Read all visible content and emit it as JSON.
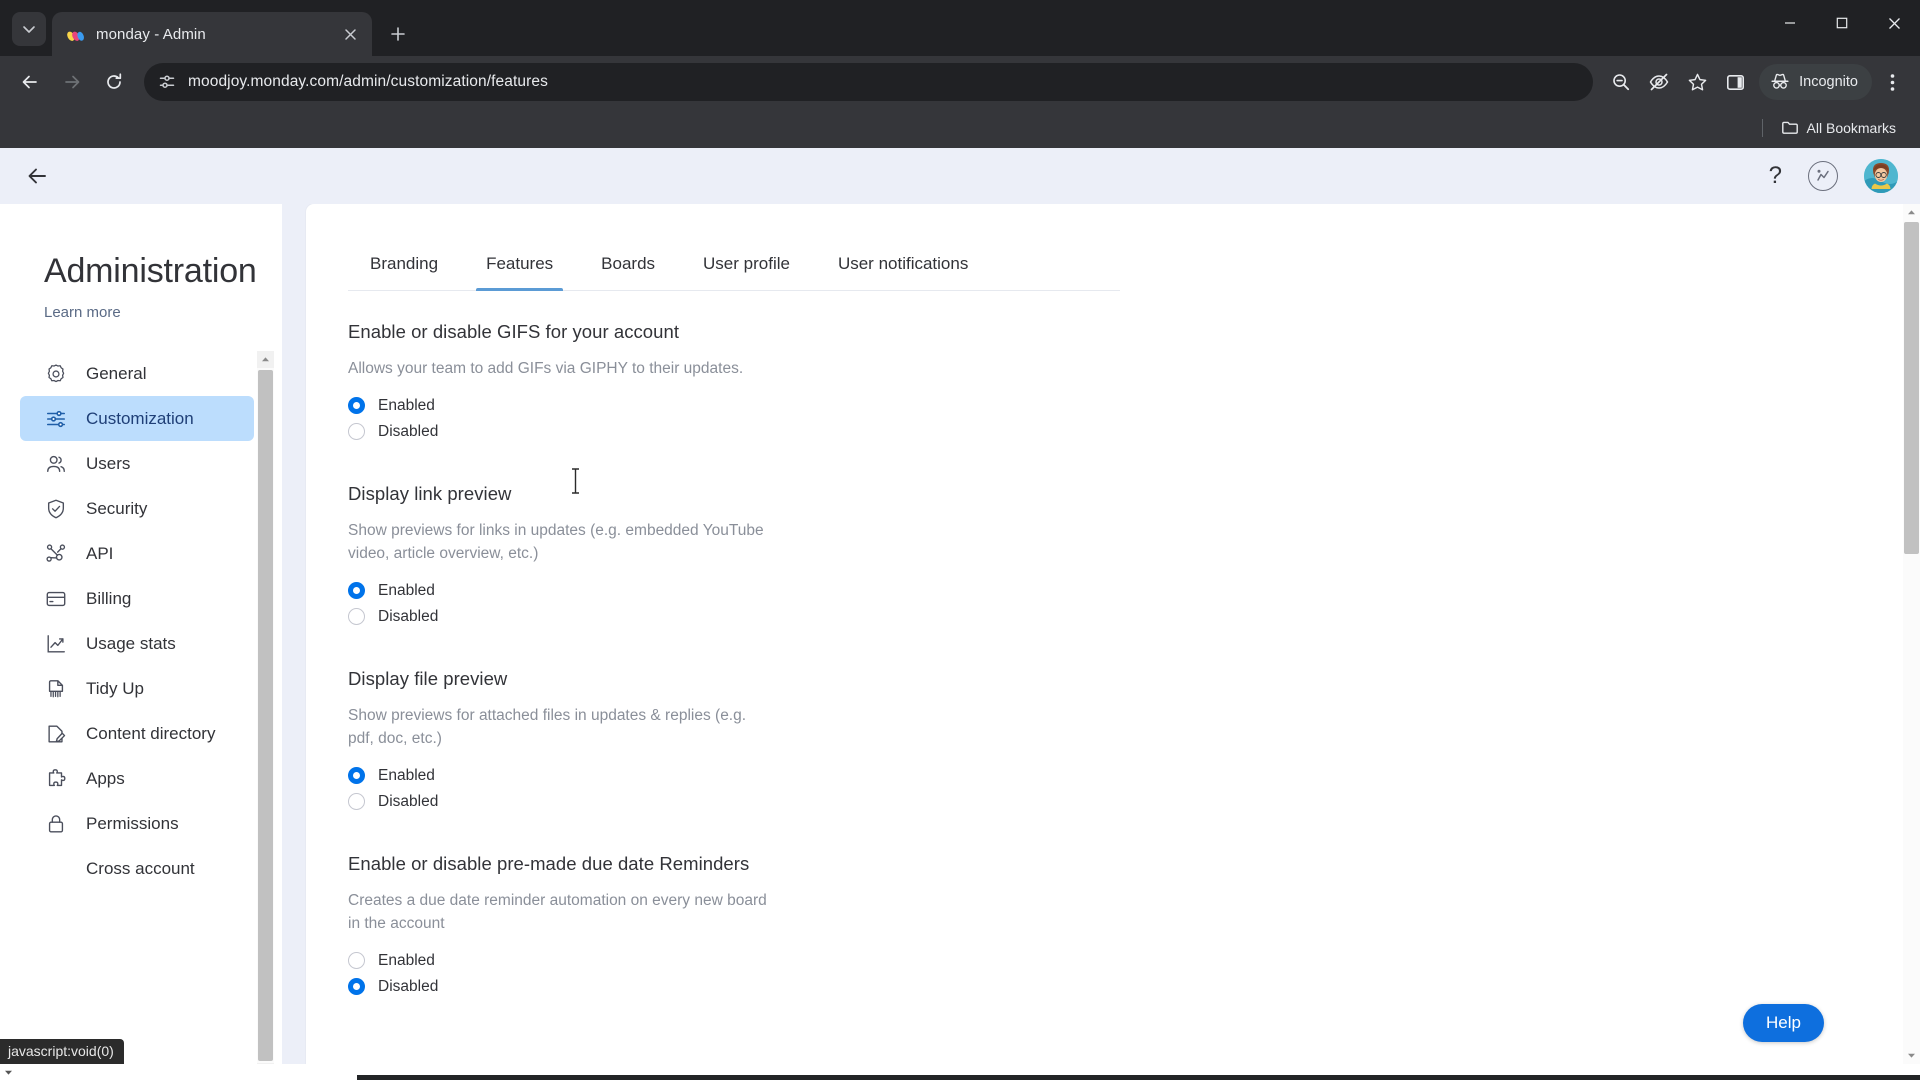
{
  "browser": {
    "tab": {
      "title": "monday - Admin",
      "favicon_name": "monday-logo-icon",
      "close_label": "×"
    },
    "tab_search_label": "⌄",
    "new_tab_label": "+",
    "window_controls": {
      "minimize": "—",
      "maximize": "▢",
      "close": "✕"
    },
    "nav": {
      "back": "←",
      "forward": "→",
      "reload": "⟳"
    },
    "omnibox": {
      "site_info_icon": "page-settings-icon",
      "url": "moodjoy.monday.com/admin/customization/features"
    },
    "toolbar_icons": [
      "zoom-out-icon",
      "eye-slash-icon",
      "bookmark-star-icon",
      "side-panel-icon"
    ],
    "profile": {
      "label": "Incognito",
      "icon": "incognito-hat-icon"
    },
    "menu_icon": "three-dot-menu-icon",
    "bookmarks": {
      "label": "All Bookmarks",
      "icon": "folder-icon"
    }
  },
  "app": {
    "header": {
      "back_icon": "back-arrow-icon",
      "help_glyph": "?",
      "activity_icon": "activity-circle-icon",
      "avatar_name": "user-avatar"
    },
    "sidebar": {
      "title": "Administration",
      "learn_more": "Learn more",
      "items": [
        {
          "label": "General",
          "icon": "gear-icon",
          "active": false
        },
        {
          "label": "Customization",
          "icon": "sliders-icon",
          "active": true
        },
        {
          "label": "Users",
          "icon": "users-icon",
          "active": false
        },
        {
          "label": "Security",
          "icon": "shield-check-icon",
          "active": false
        },
        {
          "label": "API",
          "icon": "api-nodes-icon",
          "active": false
        },
        {
          "label": "Billing",
          "icon": "credit-card-icon",
          "active": false
        },
        {
          "label": "Usage stats",
          "icon": "chart-line-icon",
          "active": false
        },
        {
          "label": "Tidy Up",
          "icon": "broom-icon",
          "active": false
        },
        {
          "label": "Content directory",
          "icon": "document-edit-icon",
          "active": false
        },
        {
          "label": "Apps",
          "icon": "puzzle-piece-icon",
          "active": false
        },
        {
          "label": "Permissions",
          "icon": "lock-icon",
          "active": false
        },
        {
          "label": "Cross account",
          "icon": "",
          "active": false
        }
      ]
    },
    "tabs": [
      {
        "label": "Branding",
        "active": false
      },
      {
        "label": "Features",
        "active": true
      },
      {
        "label": "Boards",
        "active": false
      },
      {
        "label": "User profile",
        "active": false
      },
      {
        "label": "User notifications",
        "active": false
      }
    ],
    "settings": [
      {
        "title": "Enable or disable GIFS for your account",
        "description": "Allows your team to add GIFs via GIPHY to their updates.",
        "options": [
          {
            "label": "Enabled",
            "selected": true
          },
          {
            "label": "Disabled",
            "selected": false
          }
        ]
      },
      {
        "title": "Display link preview",
        "description": "Show previews for links in updates (e.g. embedded YouTube video, article overview, etc.)",
        "options": [
          {
            "label": "Enabled",
            "selected": true
          },
          {
            "label": "Disabled",
            "selected": false
          }
        ]
      },
      {
        "title": "Display file preview",
        "description": "Show previews for attached files in updates & replies (e.g. pdf, doc, etc.)",
        "options": [
          {
            "label": "Enabled",
            "selected": true
          },
          {
            "label": "Disabled",
            "selected": false
          }
        ]
      },
      {
        "title": "Enable or disable pre-made due date Reminders",
        "description": "Creates a due date reminder automation on every new board in the account",
        "options": [
          {
            "label": "Enabled",
            "selected": false
          },
          {
            "label": "Disabled",
            "selected": true
          }
        ]
      }
    ],
    "help_button": "Help",
    "status_bubble": "javascript:void(0)"
  },
  "colors": {
    "accent_blue": "#0073ea",
    "help_blue": "#0e6fde",
    "active_nav_bg": "#bcddfd",
    "tab_underline": "#5b9bd5",
    "chrome_dark": "#202124",
    "chrome_toolbar": "#35363a",
    "app_bg": "#eceff8"
  }
}
